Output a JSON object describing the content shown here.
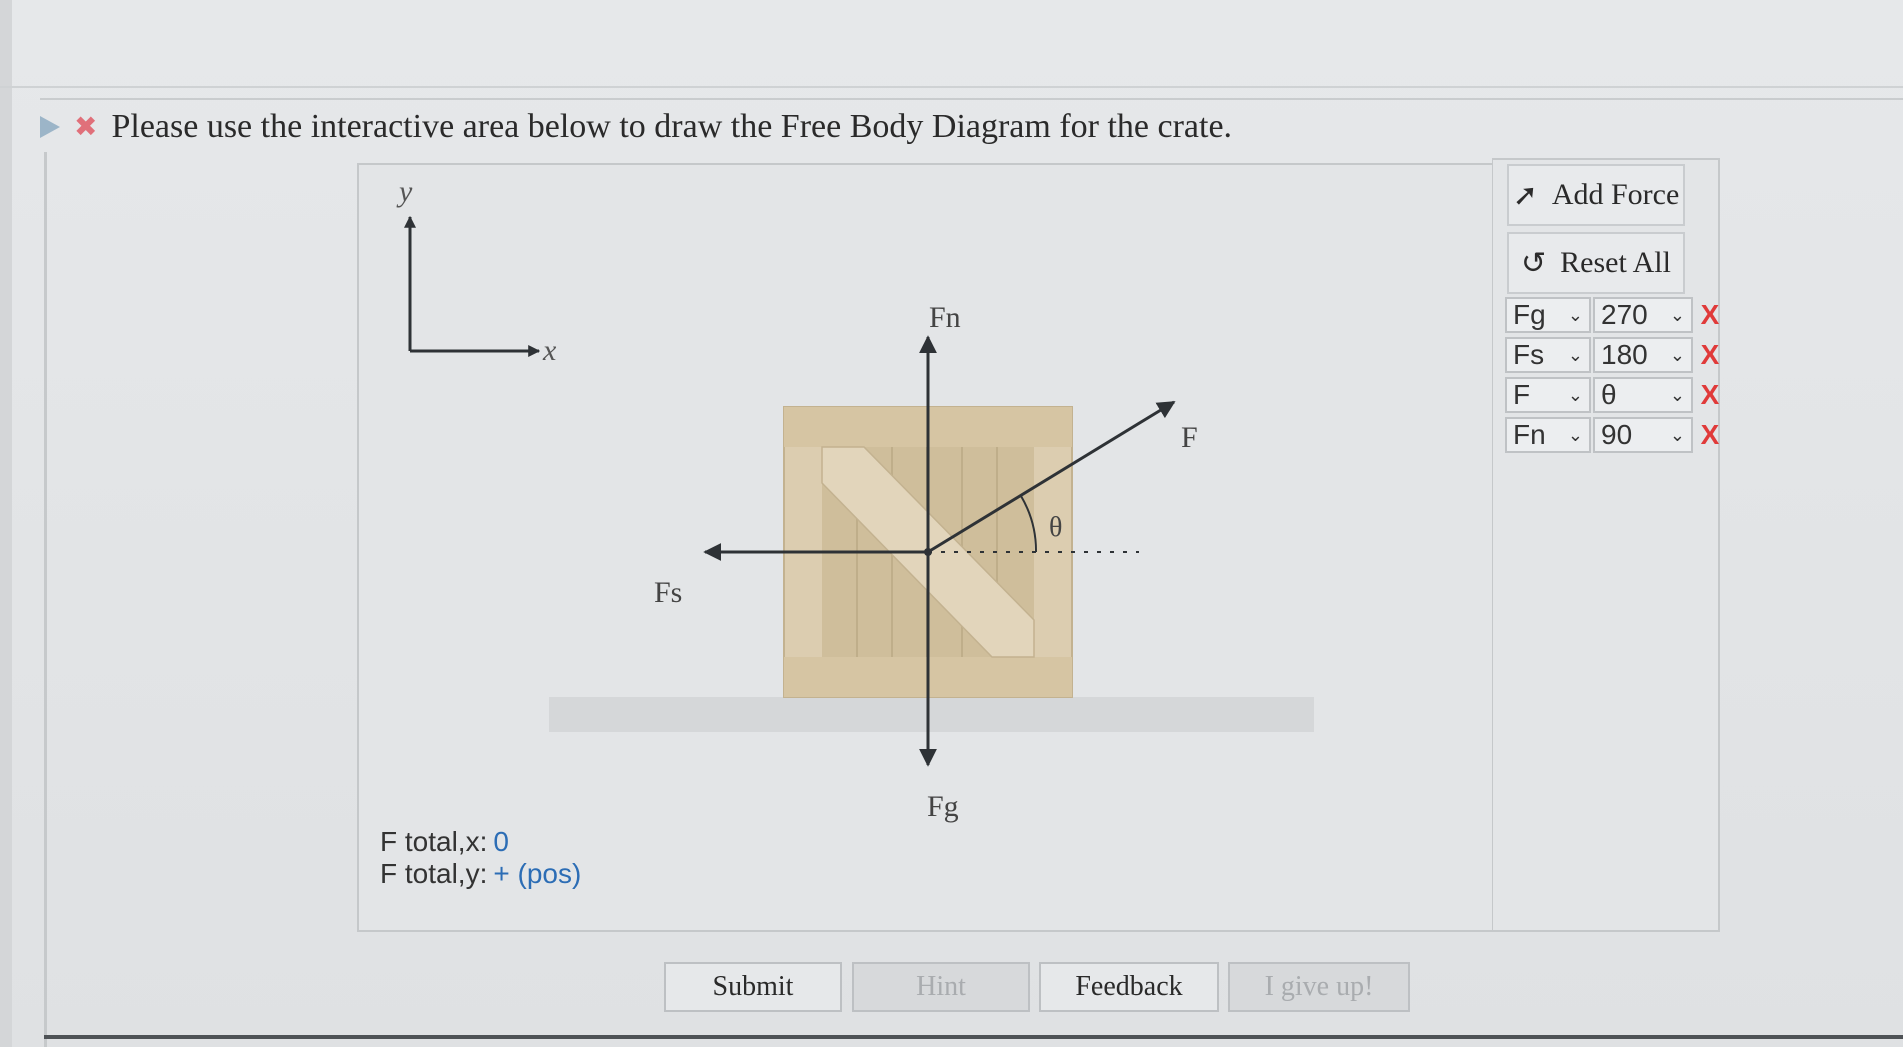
{
  "question": {
    "text": "Please use the interactive area below to draw the Free Body Diagram for the crate.",
    "status_icon": "x-mark-icon",
    "toggle_icon": "play-icon"
  },
  "diagram": {
    "axis_y_label": "y",
    "axis_x_label": "x",
    "angle_label": "θ",
    "force_labels": {
      "fn": "Fn",
      "f": "F",
      "fs": "Fs",
      "fg": "Fg"
    }
  },
  "totals": {
    "x_label": "F total,x:",
    "x_value": "0",
    "y_label": "F total,y:",
    "y_value": "+ (pos)"
  },
  "sidebar": {
    "add_force_label": "Add Force",
    "reset_all_label": "Reset All",
    "forces": [
      {
        "name": "Fg",
        "angle": "270",
        "delete": "X"
      },
      {
        "name": "Fs",
        "angle": "180",
        "delete": "X"
      },
      {
        "name": "F",
        "angle": "θ",
        "delete": "X"
      },
      {
        "name": "Fn",
        "angle": "90",
        "delete": "X"
      }
    ]
  },
  "buttons": {
    "submit": "Submit",
    "hint": "Hint",
    "feedback": "Feedback",
    "give_up": "I give up!"
  },
  "colors": {
    "crate": "#dccdb0",
    "crate_dark": "#c9b893",
    "arrow": "#2e3236",
    "wrong": "#e0707a",
    "delete": "#e03a3a",
    "total_value": "#2c6db5"
  }
}
